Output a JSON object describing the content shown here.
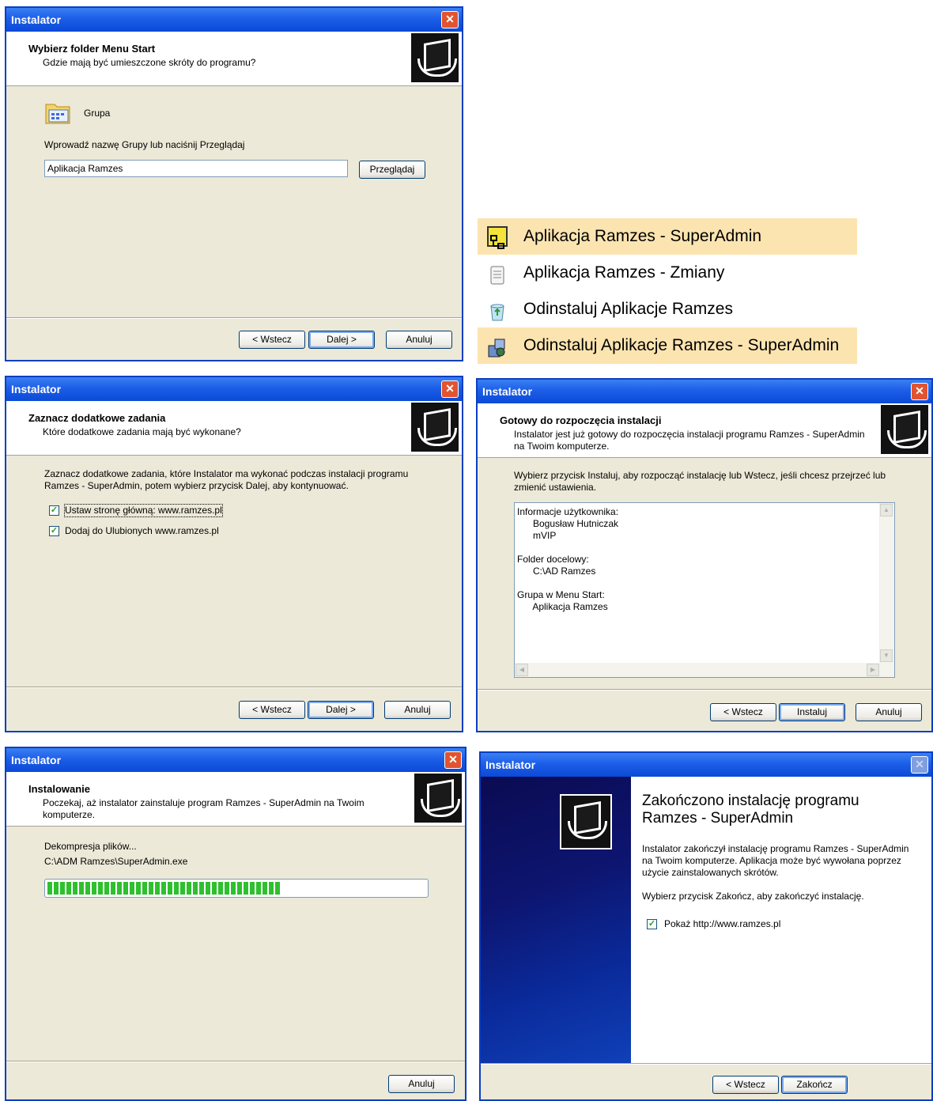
{
  "window_title": "Instalator",
  "buttons": {
    "back": "< Wstecz",
    "next": "Dalej >",
    "cancel": "Anuluj",
    "install": "Instaluj",
    "finish": "Zakończ",
    "browse": "Przeglądaj"
  },
  "dialog1": {
    "title": "Wybierz folder Menu Start",
    "subtitle": "Gdzie mają być umieszczone skróty do programu?",
    "group_label": "Grupa",
    "instruction": "Wprowadź nazwę Grupy lub naciśnij Przeglądaj",
    "input_value": "Aplikacja Ramzes"
  },
  "start_menu": {
    "items": [
      {
        "label": "Aplikacja Ramzes - SuperAdmin",
        "icon": "app-icon"
      },
      {
        "label": "Aplikacja Ramzes - Zmiany",
        "icon": "notepad-icon"
      },
      {
        "label": "Odinstaluj Aplikacje Ramzes",
        "icon": "recycle-icon"
      },
      {
        "label": "Odinstaluj Aplikacje Ramzes - SuperAdmin",
        "icon": "uninstall-icon"
      }
    ]
  },
  "dialog2": {
    "title": "Zaznacz dodatkowe zadania",
    "subtitle": "Które dodatkowe zadania mają być wykonane?",
    "instruction_line1": "Zaznacz dodatkowe zadania, które Instalator ma wykonać podczas instalacji programu",
    "instruction_line2": "Ramzes - SuperAdmin, potem wybierz przycisk Dalej, aby kontynuować.",
    "task1": "Ustaw stronę główną: www.ramzes.pl",
    "task2": "Dodaj do Ulubionych www.ramzes.pl"
  },
  "dialog3": {
    "title": "Gotowy do rozpoczęcia instalacji",
    "subtitle_line1": "Instalator jest już gotowy do rozpoczęcia instalacji programu Ramzes - SuperAdmin",
    "subtitle_line2": "na Twoim komputerze.",
    "instruction_line1": "Wybierz przycisk Instaluj, aby rozpocząć instalację lub Wstecz, jeśli chcesz przejrzeć lub",
    "instruction_line2": "zmienić ustawienia.",
    "memo": [
      "Informacje użytkownika:",
      "      Bogusław Hutniczak",
      "      mVIP",
      "",
      "Folder docelowy:",
      "      C:\\AD Ramzes",
      "",
      "Grupa w Menu Start:",
      "      Aplikacja Ramzes"
    ]
  },
  "dialog4": {
    "title": "Instalowanie",
    "subtitle_line1": "Poczekaj, aż instalator zainstaluje program Ramzes - SuperAdmin na Twoim",
    "subtitle_line2": "komputerze.",
    "status": "Dekompresja plików...",
    "file": "C:\\ADM Ramzes\\SuperAdmin.exe",
    "progress": 0.62
  },
  "dialog5": {
    "heading_line1": "Zakończono instalację programu",
    "heading_line2": "Ramzes - SuperAdmin",
    "body_line1": "Instalator zakończył instalację programu Ramzes - SuperAdmin",
    "body_line2": "na Twoim komputerze. Aplikacja może być wywołana poprzez",
    "body_line3": "użycie zainstalowanych skrótów.",
    "instruction": "Wybierz przycisk Zakończ, aby zakończyć instalację.",
    "show_site": "Pokaż http://www.ramzes.pl"
  }
}
